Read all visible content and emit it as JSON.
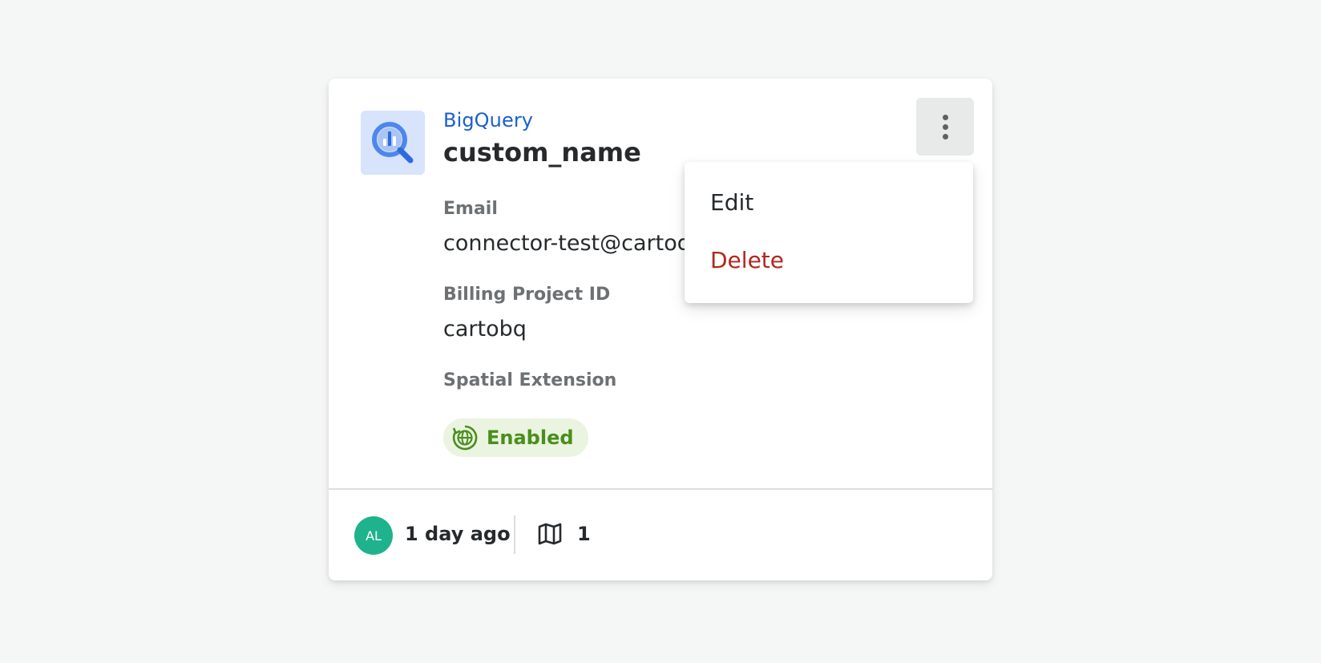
{
  "connection": {
    "provider": "BigQuery",
    "name": "custom_name",
    "provider_icon": "bigquery-logo-icon",
    "fields": [
      {
        "label": "Email",
        "value": "connector-test@cartod"
      },
      {
        "label": "Billing Project ID",
        "value": "cartobq"
      },
      {
        "label": "Spatial Extension",
        "value": "Enabled"
      }
    ]
  },
  "menu": {
    "button_icon": "more-vertical-icon",
    "items": [
      {
        "label": "Edit"
      },
      {
        "label": "Delete"
      }
    ]
  },
  "footer": {
    "avatar_initials": "AL",
    "time_ago": "1 day ago",
    "map_icon": "map-icon",
    "map_count": "1"
  },
  "colors": {
    "provider_link": "#1a5fd0",
    "delete": "#b3261e",
    "enabled_text": "#4a8e1d",
    "enabled_bg": "#eaf4e0",
    "avatar_bg": "#1eb38c",
    "logo_bg": "#d7e4fb"
  }
}
